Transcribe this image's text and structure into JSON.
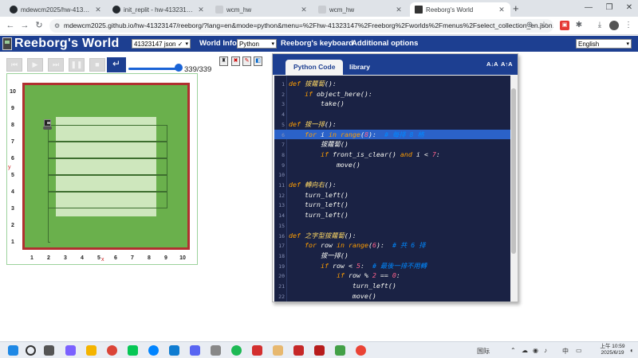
{
  "browser": {
    "tabs": [
      {
        "label": "mdewcm2025/hw-41323147",
        "icon": "github-icon",
        "active": false
      },
      {
        "label": "init_replit - hw-41323147 [Co",
        "icon": "github-icon",
        "active": false
      },
      {
        "label": "wcm_hw",
        "icon": "page-icon",
        "active": false
      },
      {
        "label": "wcm_hw",
        "icon": "page-icon",
        "active": false
      },
      {
        "label": "Reeborg's World",
        "icon": "reeborg-icon",
        "active": true
      }
    ],
    "url": "mdewcm2025.github.io/hw-41323147/reeborg/?lang=en&mode=python&menu=%2Fhw-41323147%2Freeborg%2Fworlds%2Fmenus%2Fselect_collection_en.json..."
  },
  "header": {
    "title": "Reeborg's World",
    "world_select": "41323147 json ✓",
    "world_info": "World Info",
    "language_select": "Python",
    "keyboard": "Reeborg's keyboard",
    "additional_options": "Additional options",
    "ui_language": "English"
  },
  "controls": {
    "step_count": "339/339",
    "slider_fraction": 1.0
  },
  "world": {
    "x_labels": [
      "1",
      "2",
      "3",
      "4",
      "5",
      "6",
      "7",
      "8",
      "9",
      "10"
    ],
    "y_labels": [
      "10",
      "9",
      "8",
      "7",
      "6",
      "5",
      "4",
      "3",
      "2",
      "1"
    ],
    "x_letter": "x",
    "y_letter": "y"
  },
  "editor": {
    "tabs": [
      "Python Code",
      "library"
    ],
    "font_minus": "A↓A",
    "font_plus": "A↑A",
    "highlight_line": 6,
    "lines": [
      {
        "n": "1",
        "html": "<span class='kw'>def</span> <span class='fn'>拔蘿蔔</span>():"
      },
      {
        "n": "2",
        "html": "    <span class='kw'>if</span> object_here():"
      },
      {
        "n": "3",
        "html": "        take()"
      },
      {
        "n": "4",
        "html": ""
      },
      {
        "n": "5",
        "html": "<span class='kw'>def</span> <span class='fn'>拔一排</span>():"
      },
      {
        "n": "6",
        "html": "    <span class='kw'>for</span> i <span class='kw'>in</span> <span class='bi'>range</span>(<span class='num'>8</span>):  <span class='cm'># 每排 8 格</span>"
      },
      {
        "n": "7",
        "html": "        拔蘿蔔()"
      },
      {
        "n": "8",
        "html": "        <span class='kw'>if</span> front_is_clear() <span class='kw'>and</span> i &lt; <span class='num'>7</span>:"
      },
      {
        "n": "9",
        "html": "            move()"
      },
      {
        "n": "10",
        "html": ""
      },
      {
        "n": "11",
        "html": "<span class='kw'>def</span> <span class='fn'>轉向右</span>():"
      },
      {
        "n": "12",
        "html": "    turn_left()"
      },
      {
        "n": "13",
        "html": "    turn_left()"
      },
      {
        "n": "14",
        "html": "    turn_left()"
      },
      {
        "n": "15",
        "html": ""
      },
      {
        "n": "16",
        "html": "<span class='kw'>def</span> <span class='fn'>之字型拔蘿蔔</span>():"
      },
      {
        "n": "17",
        "html": "    <span class='kw'>for</span> row <span class='kw'>in</span> <span class='bi'>range</span>(<span class='num'>6</span>):  <span class='cm'># 共 6 排</span>"
      },
      {
        "n": "18",
        "html": "        拔一排()"
      },
      {
        "n": "19",
        "html": "        <span class='kw'>if</span> row &lt; <span class='num'>5</span>:  <span class='cm'># 最後一排不用轉</span>"
      },
      {
        "n": "20",
        "html": "            <span class='kw'>if</span> row % <span class='num'>2</span> == <span class='num'>0</span>:"
      },
      {
        "n": "21",
        "html": "                turn_left()"
      },
      {
        "n": "22",
        "html": "                move()"
      }
    ]
  },
  "taskbar": {
    "clock_time": "上午 10:59",
    "clock_date": "2025/6/19",
    "ime": "中",
    "weather": "国际"
  },
  "colors": {
    "brand": "#1d3f91",
    "grass": "#6ab04c",
    "wall": "#b03030",
    "editor_bg": "#1a2244",
    "highlight": "#2b62c9"
  }
}
